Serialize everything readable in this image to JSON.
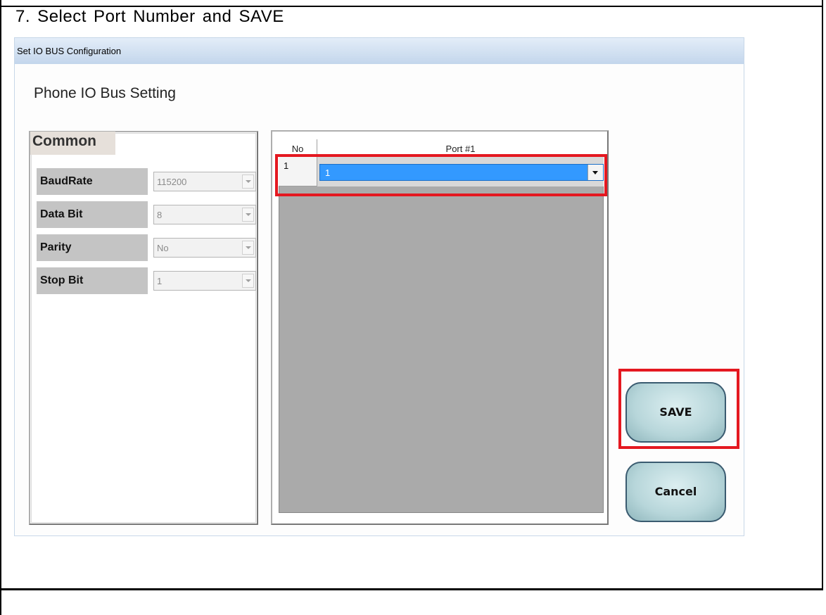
{
  "step": {
    "title": "7. Select Port Number and SAVE"
  },
  "window": {
    "title": "Set IO BUS Configuration"
  },
  "dialog": {
    "heading": "Phone IO Bus Setting"
  },
  "common": {
    "legend": "Common",
    "fields": [
      {
        "label": "BaudRate",
        "value": "115200"
      },
      {
        "label": "Data Bit",
        "value": "8"
      },
      {
        "label": "Parity",
        "value": "No"
      },
      {
        "label": "Stop Bit",
        "value": "1"
      }
    ]
  },
  "port_grid": {
    "columns": [
      "No",
      "Port #1"
    ],
    "rows": [
      {
        "no": "1",
        "port": "1"
      }
    ]
  },
  "buttons": {
    "save": "SAVE",
    "cancel": "Cancel"
  },
  "colors": {
    "highlight": "#e41820",
    "selection": "#3399ff",
    "grid_background": "#aaaaaa"
  }
}
